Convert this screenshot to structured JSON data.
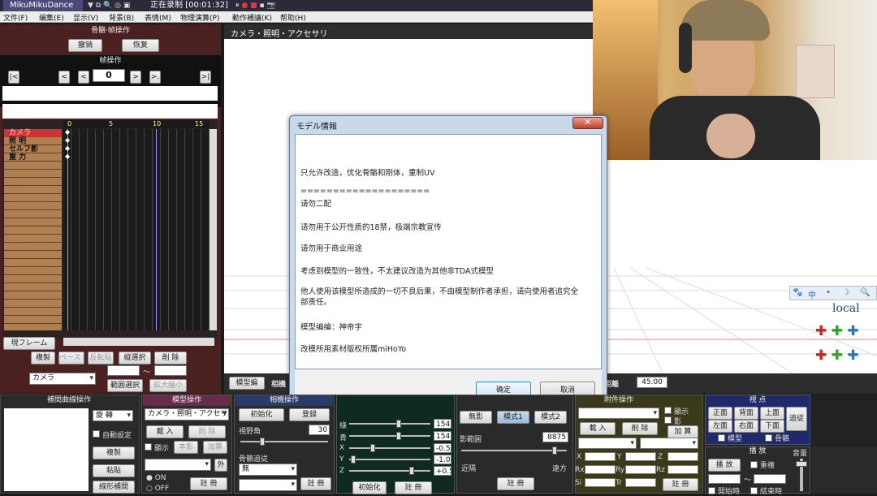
{
  "titlebar": {
    "app": "MikuMikuDance",
    "recording": "正在录制 [00:01:32]"
  },
  "menu": [
    "文件(F)",
    "编集(E)",
    "显示(V)",
    "背景(B)",
    "表情(M)",
    "物理演算(P)",
    "動作補讓(K)",
    "帮助(H)"
  ],
  "left_panel": {
    "bone_ops_title": "骨骼·帧操作",
    "undo": "撤销",
    "redo": "恢复",
    "frame_ops_title": "帧操作",
    "frame_value": "0",
    "nav": [
      "|<",
      "<",
      "<",
      ">",
      ">.",
      ">|"
    ],
    "ruler": [
      "0",
      "5",
      "10",
      "15"
    ],
    "tracks": [
      "カメラ",
      "照 明",
      "セルフ影",
      "重 力"
    ],
    "current_frame_btn": "現フレーム",
    "copy": "複製",
    "paste": "ペースト",
    "reverse": "反転貼",
    "range_select": "縦選択",
    "delete": "削 除",
    "tilde": "〜",
    "camera_select": "カメラ",
    "range_select2": "範囲選択",
    "zoom": "拡大縮小"
  },
  "viewport": {
    "header": "カメラ・照明・アクセサリ",
    "local": "local",
    "tab_model": "模型編",
    "tab_camera": "相機",
    "distance_label": "距離",
    "distance_value": "45.00",
    "view_icons": [
      "🐾",
      "中",
      "•",
      "☽",
      "🔍"
    ]
  },
  "dialog": {
    "title": "モデル情報",
    "lines": [
      "只允许改造，优化骨骼和刚体，重制UV",
      "====================",
      "请勿二配",
      "请勿用于公开性质的18禁，极端宗教宣传",
      "请勿用于商业用途",
      "考虑到模型的一致性，不太建议改造为其他非TDA式模型",
      "他人使用该模型所造成的一切不良后果，不由模型制作者承担，请向使用者追究全部责任。",
      "模型编编：神帝宇",
      "改模所用素材版权所属miHoYo"
    ],
    "ok": "确定",
    "cancel": "取消"
  },
  "bottom": {
    "interp_title": "補間曲線操作",
    "rotate": "旋 轉",
    "auto": "自動設定",
    "copy": "複製",
    "paste": "粘貼",
    "linear": "線形補間",
    "model_title": "模型操作",
    "model_select": "カメラ・照明・アクセサリ",
    "load": "載 入",
    "delete": "削 除",
    "show": "顯示",
    "dup": "本影",
    "add": "加算",
    "ext": "外",
    "on": "ON",
    "off": "OFF",
    "register": "註 冊",
    "camera_title": "相機操作",
    "init": "初始化",
    "reg_small": "登録",
    "fov_label": "視野角",
    "fov_value": "30",
    "perspective_label": "骨骼追従",
    "perspective_value": "無",
    "light_labels": [
      "綠",
      "青",
      "X",
      "Y",
      "Z"
    ],
    "light_values": [
      "154",
      "154",
      "-0.5",
      "-1.0",
      "+0.5"
    ],
    "light_init": "初始化",
    "light_register": "註 冊",
    "shadow_btn1": "無影",
    "shadow_btn2": "模式1",
    "shadow_btn3": "模式2",
    "shadow_dist_label": "影範囲",
    "shadow_dist_value": "8875",
    "near": "近隔",
    "far": "遠方",
    "shadow_register": "註 冊",
    "acc_title": "附件操作",
    "acc_show": "顯示",
    "acc_shadow": "影",
    "acc_load": "載 入",
    "acc_delete": "削 除",
    "acc_add": "加 算",
    "acc_coords": [
      "X",
      "Y",
      "Z",
      "Rx",
      "Ry",
      "Rz",
      "Si",
      "Tr"
    ],
    "acc_register": "註 冊",
    "view_title": "視 点",
    "front": "正面",
    "back": "背面",
    "top": "上面",
    "left": "左面",
    "right": "右面",
    "bottom": "下面",
    "follow": "追従",
    "model_chk": "模型",
    "bone_chk": "骨骼",
    "play_title": "播 放",
    "play": "播 放",
    "repeat": "重複",
    "tilde": "〜",
    "volume": "音量",
    "stop_check": "開始時",
    "end_check": "結束時"
  }
}
